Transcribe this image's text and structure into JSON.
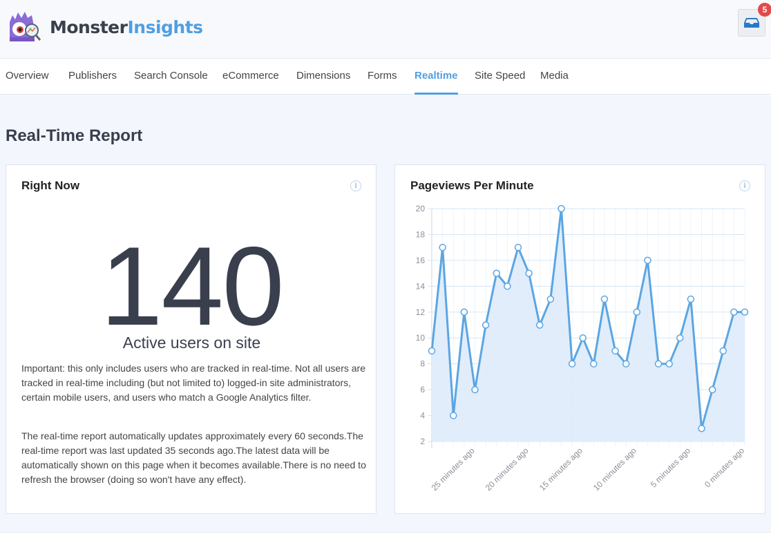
{
  "header": {
    "brand_part1": "Monster",
    "brand_part2": "Insights",
    "notifications_count": "5"
  },
  "nav": {
    "tabs": [
      {
        "label": "Overview",
        "active": false
      },
      {
        "label": "Publishers",
        "active": false
      },
      {
        "label": "Search Console",
        "active": false
      },
      {
        "label": "eCommerce",
        "active": false
      },
      {
        "label": "Dimensions",
        "active": false
      },
      {
        "label": "Forms",
        "active": false
      },
      {
        "label": "Realtime",
        "active": true
      },
      {
        "label": "Site Speed",
        "active": false
      },
      {
        "label": "Media",
        "active": false
      }
    ]
  },
  "page": {
    "title": "Real-Time Report"
  },
  "right_now": {
    "title": "Right Now",
    "active_users": "140",
    "active_users_label": "Active users on site",
    "paragraph1": "Important: this only includes users who are tracked in real-time. Not all users are tracked in real-time including (but not limited to) logged-in site administrators, certain mobile users, and users who match a Google Analytics filter.",
    "paragraph2": "The real-time report automatically updates approximately every 60 seconds.The real-time report was last updated 35 seconds ago.The latest data will be automatically shown on this page when it becomes available.There is no need to refresh the browser (doing so won't have any effect)."
  },
  "pageviews": {
    "title": "Pageviews Per Minute"
  },
  "colors": {
    "accent": "#509fe2",
    "line": "#5ba5e3",
    "fill": "#deebf9",
    "text_dark": "#393f4c",
    "badge": "#e04a4a"
  },
  "chart_data": {
    "type": "area",
    "title": "Pageviews Per Minute",
    "xlabel": "",
    "ylabel": "",
    "x_minutes_ago": [
      29,
      28,
      27,
      26,
      25,
      24,
      23,
      22,
      21,
      20,
      19,
      18,
      17,
      16,
      15,
      14,
      13,
      12,
      11,
      10,
      9,
      8,
      7,
      6,
      5,
      4,
      3,
      2,
      1,
      0
    ],
    "values": [
      9,
      17,
      4,
      12,
      6,
      11,
      15,
      14,
      17,
      15,
      11,
      13,
      20,
      8,
      10,
      8,
      13,
      9,
      8,
      12,
      16,
      8,
      8,
      10,
      13,
      3,
      6,
      9,
      12,
      12
    ],
    "x_tick_labels": [
      {
        "index": 4,
        "label": "25 minutes ago"
      },
      {
        "index": 9,
        "label": "20 minutes ago"
      },
      {
        "index": 14,
        "label": "15 minutes ago"
      },
      {
        "index": 19,
        "label": "10 minutes ago"
      },
      {
        "index": 24,
        "label": "5 minutes ago"
      },
      {
        "index": 29,
        "label": "0 minutes ago"
      }
    ],
    "y_ticks": [
      2,
      4,
      6,
      8,
      10,
      12,
      14,
      16,
      18,
      20
    ],
    "ylim": [
      2,
      20
    ],
    "grid": true,
    "legend": "none"
  }
}
